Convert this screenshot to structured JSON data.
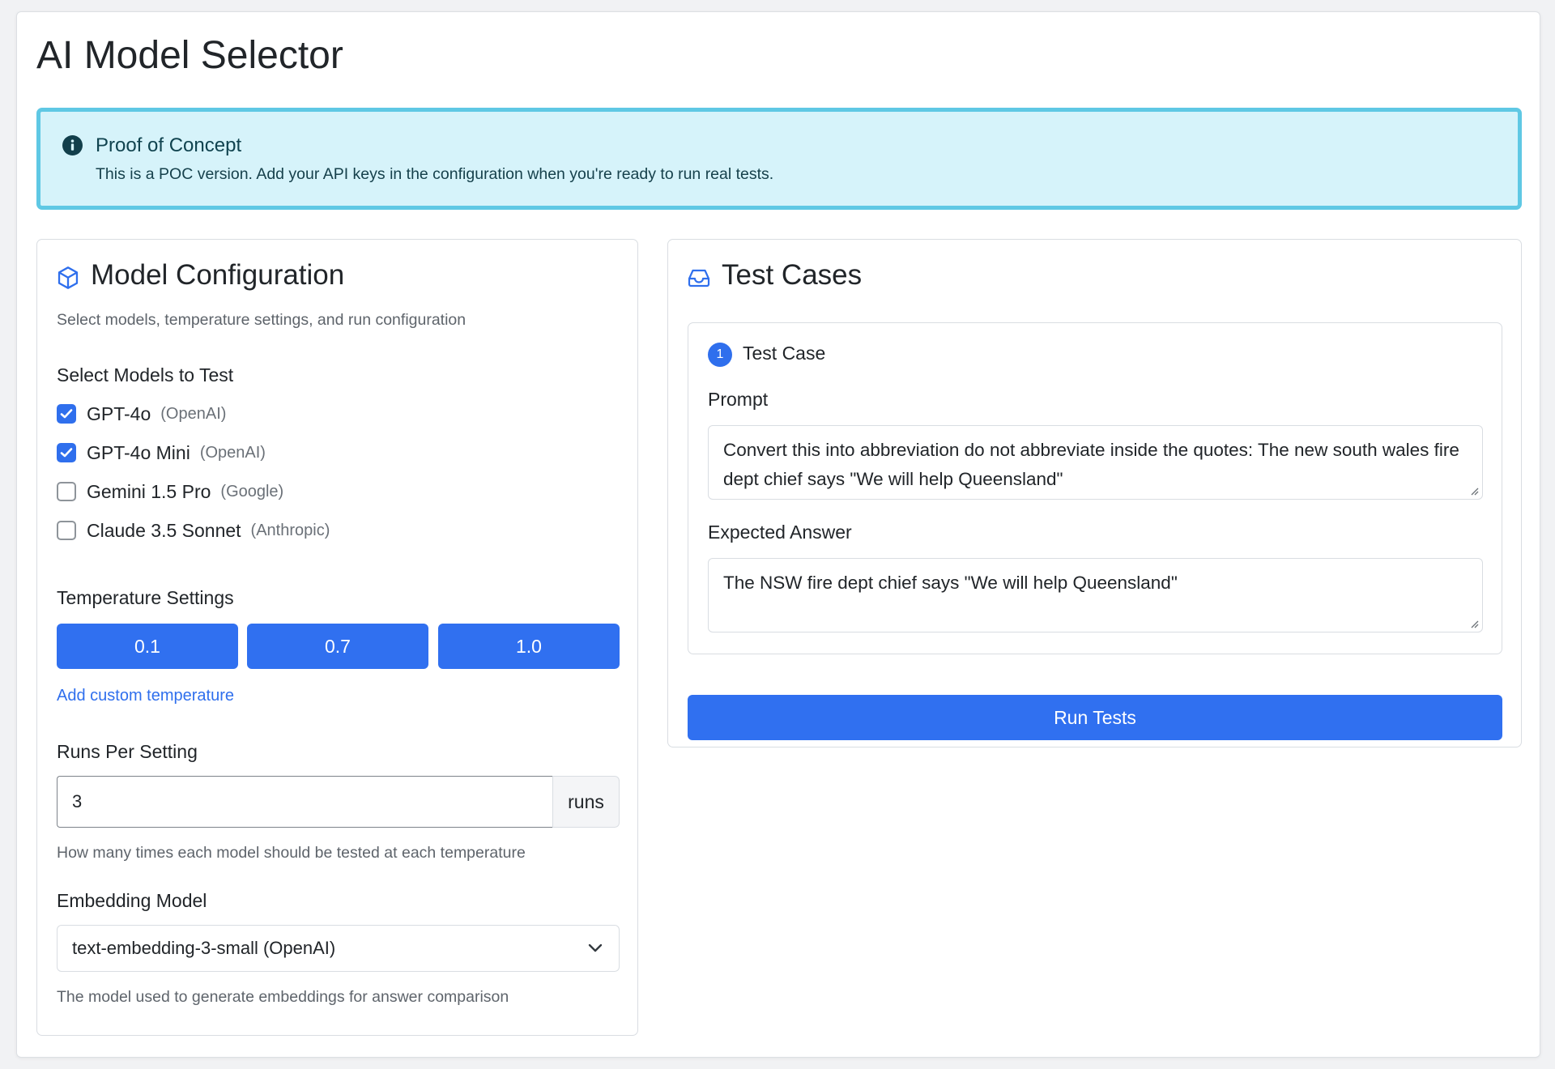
{
  "app": {
    "title": "AI Model Selector"
  },
  "alert": {
    "icon": "info-circle-icon",
    "title": "Proof of Concept",
    "message": "This is a POC version. Add your API keys in the configuration when you're ready to run real tests."
  },
  "model_config": {
    "icon": "cube-icon",
    "title": "Model Configuration",
    "subtitle": "Select models, temperature settings, and run configuration",
    "models_label": "Select Models to Test",
    "models": [
      {
        "name": "GPT-4o",
        "provider": "(OpenAI)",
        "checked": true
      },
      {
        "name": "GPT-4o Mini",
        "provider": "(OpenAI)",
        "checked": true
      },
      {
        "name": "Gemini 1.5 Pro",
        "provider": "(Google)",
        "checked": false
      },
      {
        "name": "Claude 3.5 Sonnet",
        "provider": "(Anthropic)",
        "checked": false
      }
    ],
    "temperature_label": "Temperature Settings",
    "temperatures": [
      "0.1",
      "0.7",
      "1.0"
    ],
    "add_custom_temperature": "Add custom temperature",
    "runs_label": "Runs Per Setting",
    "runs_value": "3",
    "runs_unit": "runs",
    "runs_help": "How many times each model should be tested at each temperature",
    "embedding_label": "Embedding Model",
    "embedding_selected": "text-embedding-3-small (OpenAI)",
    "embedding_help": "The model used to generate embeddings for answer comparison"
  },
  "test_cases": {
    "icon": "inbox-icon",
    "title": "Test Cases",
    "cases": [
      {
        "number": "1",
        "title": "Test Case",
        "prompt_label": "Prompt",
        "prompt": "Convert this into abbreviation do not abbreviate inside the quotes: The new south wales fire dept chief says \"We will help Queensland\"",
        "expected_label": "Expected Answer",
        "expected": "The NSW fire dept chief says \"We will help Queensland\""
      }
    ],
    "run_button": "Run Tests"
  },
  "colors": {
    "primary": "#3070f0",
    "alert_bg": "#d6f3fa",
    "alert_border": "#5fc8e4"
  }
}
